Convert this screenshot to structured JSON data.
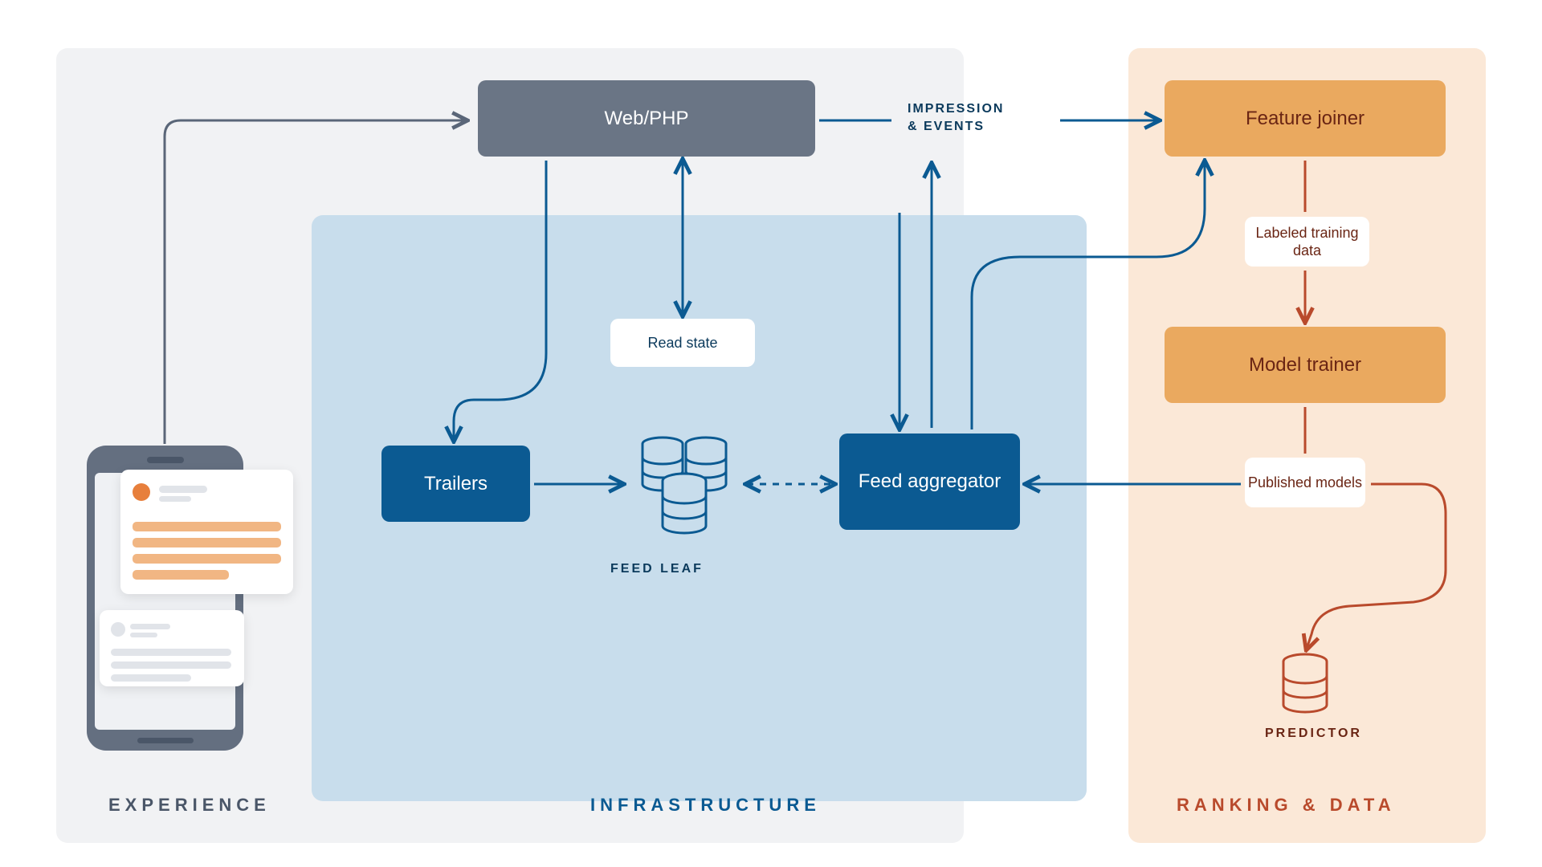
{
  "sections": {
    "experience": "EXPERIENCE",
    "infrastructure": "INFRASTRUCTURE",
    "ranking": "RANKING & DATA"
  },
  "nodes": {
    "webphp": "Web/PHP",
    "trailers": "Trailers",
    "feed_aggregator": "Feed aggregator",
    "feature_joiner": "Feature joiner",
    "model_trainer": "Model trainer"
  },
  "chips": {
    "read_state": "Read state",
    "labeled_training_data": "Labeled training data",
    "published_models": "Published models"
  },
  "captions": {
    "feed_leaf": "FEED LEAF",
    "predictor": "PREDICTOR",
    "impression_events_l1": "IMPRESSION",
    "impression_events_l2": "& EVENTS"
  },
  "colors": {
    "gray_panel": "#f1f2f4",
    "blue_panel": "#c8ddec",
    "orange_panel": "#fbe8d7",
    "gray_box": "#6a7585",
    "blue_box": "#0b5a92",
    "orange_box": "#eaa95f",
    "blue_line": "#0b5a92",
    "red_line": "#b94a2c",
    "gray_line": "#5a6678"
  }
}
